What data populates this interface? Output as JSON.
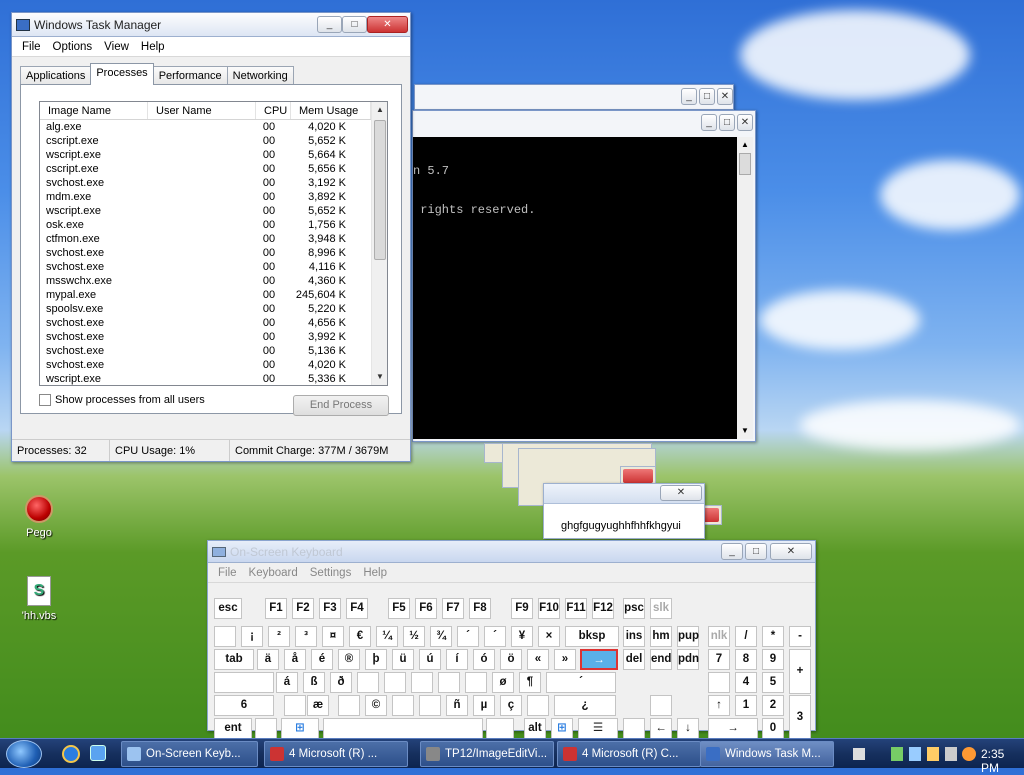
{
  "desktop": {
    "icons": [
      {
        "label": "Pego",
        "icon": "red-circle-app-icon"
      },
      {
        "label": "'hh.vbs",
        "icon": "vbscript-file-icon"
      }
    ]
  },
  "task_manager": {
    "title": "Windows Task Manager",
    "menu": [
      "File",
      "Options",
      "View",
      "Help"
    ],
    "tabs": [
      "Applications",
      "Processes",
      "Performance",
      "Networking"
    ],
    "active_tab": "Processes",
    "columns": [
      "Image Name",
      "User Name",
      "CPU",
      "Mem Usage"
    ],
    "rows": [
      {
        "name": "alg.exe",
        "user": "",
        "cpu": "00",
        "mem": "4,020 K"
      },
      {
        "name": "cscript.exe",
        "user": "",
        "cpu": "00",
        "mem": "5,652 K"
      },
      {
        "name": "wscript.exe",
        "user": "",
        "cpu": "00",
        "mem": "5,664 K"
      },
      {
        "name": "cscript.exe",
        "user": "",
        "cpu": "00",
        "mem": "5,656 K"
      },
      {
        "name": "svchost.exe",
        "user": "",
        "cpu": "00",
        "mem": "3,192 K"
      },
      {
        "name": "mdm.exe",
        "user": "",
        "cpu": "00",
        "mem": "3,892 K"
      },
      {
        "name": "wscript.exe",
        "user": "",
        "cpu": "00",
        "mem": "5,652 K"
      },
      {
        "name": "osk.exe",
        "user": "",
        "cpu": "00",
        "mem": "1,756 K"
      },
      {
        "name": "ctfmon.exe",
        "user": "",
        "cpu": "00",
        "mem": "3,948 K"
      },
      {
        "name": "svchost.exe",
        "user": "",
        "cpu": "00",
        "mem": "8,996 K"
      },
      {
        "name": "svchost.exe",
        "user": "",
        "cpu": "00",
        "mem": "4,116 K"
      },
      {
        "name": "msswchx.exe",
        "user": "",
        "cpu": "00",
        "mem": "4,360 K"
      },
      {
        "name": "mypal.exe",
        "user": "",
        "cpu": "00",
        "mem": "245,604 K"
      },
      {
        "name": "spoolsv.exe",
        "user": "",
        "cpu": "00",
        "mem": "5,220 K"
      },
      {
        "name": "svchost.exe",
        "user": "",
        "cpu": "00",
        "mem": "4,656 K"
      },
      {
        "name": "svchost.exe",
        "user": "",
        "cpu": "00",
        "mem": "3,992 K"
      },
      {
        "name": "svchost.exe",
        "user": "",
        "cpu": "00",
        "mem": "5,136 K"
      },
      {
        "name": "svchost.exe",
        "user": "",
        "cpu": "00",
        "mem": "4,020 K"
      },
      {
        "name": "wscript.exe",
        "user": "",
        "cpu": "00",
        "mem": "5,336 K"
      }
    ],
    "show_all_label": "Show processes from all users",
    "end_process_label": "End Process",
    "status": {
      "processes": "Processes: 32",
      "cpu": "CPU Usage: 1%",
      "commit": "Commit Charge: 377M / 3679M"
    }
  },
  "console": {
    "lines": [
      "n 5.7",
      " rights reserved."
    ]
  },
  "popup": {
    "text": "ghgfgugyughhfhhfkhgyui"
  },
  "osk": {
    "title": "On-Screen Keyboard",
    "menu": [
      "File",
      "Keyboard",
      "Settings",
      "Help"
    ],
    "keys": [
      {
        "label": "esc"
      },
      {
        "label": "F1"
      },
      {
        "label": "F2"
      },
      {
        "label": "F3"
      },
      {
        "label": "F4"
      },
      {
        "label": "F5"
      },
      {
        "label": "F6"
      },
      {
        "label": "F7"
      },
      {
        "label": "F8"
      },
      {
        "label": "F9"
      },
      {
        "label": "F10"
      },
      {
        "label": "F11"
      },
      {
        "label": "F12"
      },
      {
        "label": "psc"
      },
      {
        "label": "slk"
      },
      {
        "label": ""
      },
      {
        "label": "¡"
      },
      {
        "label": "²"
      },
      {
        "label": "³"
      },
      {
        "label": "¤"
      },
      {
        "label": "€"
      },
      {
        "label": "¼"
      },
      {
        "label": "½"
      },
      {
        "label": "¾"
      },
      {
        "label": "´"
      },
      {
        "label": "´"
      },
      {
        "label": "¥"
      },
      {
        "label": "×"
      },
      {
        "label": "bksp"
      },
      {
        "label": "ins"
      },
      {
        "label": "hm"
      },
      {
        "label": "pup"
      },
      {
        "label": "nlk"
      },
      {
        "label": "/"
      },
      {
        "label": "*"
      },
      {
        "label": "-"
      },
      {
        "label": "tab"
      },
      {
        "label": "ä"
      },
      {
        "label": "å"
      },
      {
        "label": "é"
      },
      {
        "label": "®"
      },
      {
        "label": "þ"
      },
      {
        "label": "ü"
      },
      {
        "label": "ú"
      },
      {
        "label": "í"
      },
      {
        "label": "ó"
      },
      {
        "label": "ö"
      },
      {
        "label": "«"
      },
      {
        "label": "»"
      },
      {
        "label": "→"
      },
      {
        "label": "del"
      },
      {
        "label": "end"
      },
      {
        "label": "pdn"
      },
      {
        "label": "7"
      },
      {
        "label": "8"
      },
      {
        "label": "9"
      },
      {
        "label": "+"
      },
      {
        "label": ""
      },
      {
        "label": "á"
      },
      {
        "label": "ß"
      },
      {
        "label": "ð"
      },
      {
        "label": ""
      },
      {
        "label": ""
      },
      {
        "label": ""
      },
      {
        "label": ""
      },
      {
        "label": ""
      },
      {
        "label": "ø"
      },
      {
        "label": "¶"
      },
      {
        "label": "´"
      },
      {
        "label": ""
      },
      {
        "label": "4"
      },
      {
        "label": "5"
      },
      {
        "label": "6"
      },
      {
        "label": ""
      },
      {
        "label": "æ"
      },
      {
        "label": ""
      },
      {
        "label": "©"
      },
      {
        "label": ""
      },
      {
        "label": ""
      },
      {
        "label": "ñ"
      },
      {
        "label": "µ"
      },
      {
        "label": "ç"
      },
      {
        "label": ""
      },
      {
        "label": "¿"
      },
      {
        "label": ""
      },
      {
        "label": "↑"
      },
      {
        "label": "1"
      },
      {
        "label": "2"
      },
      {
        "label": "3"
      },
      {
        "label": "ent"
      },
      {
        "label": ""
      },
      {
        "label": "win-icon"
      },
      {
        "label": ""
      },
      {
        "label": ""
      },
      {
        "label": "alt"
      },
      {
        "label": "win-icon"
      },
      {
        "label": "menu-icon"
      },
      {
        "label": ""
      },
      {
        "label": "←"
      },
      {
        "label": "↓"
      },
      {
        "label": "→"
      },
      {
        "label": "0"
      },
      {
        "label": "."
      }
    ]
  },
  "taskbar": {
    "items": [
      {
        "label": "On-Screen Keyb...",
        "icon": "keyboard-icon",
        "active": false
      },
      {
        "label": "4 Microsoft (R) ...",
        "icon": "app-icon",
        "active": false
      },
      {
        "label": "TP12/ImageEditVi...",
        "icon": "gear-icon",
        "active": false
      },
      {
        "label": "4 Microsoft (R) C...",
        "icon": "console-icon",
        "active": false
      },
      {
        "label": "Windows Task M...",
        "icon": "taskmgr-icon",
        "active": true
      }
    ],
    "clock": "2:35 PM"
  }
}
